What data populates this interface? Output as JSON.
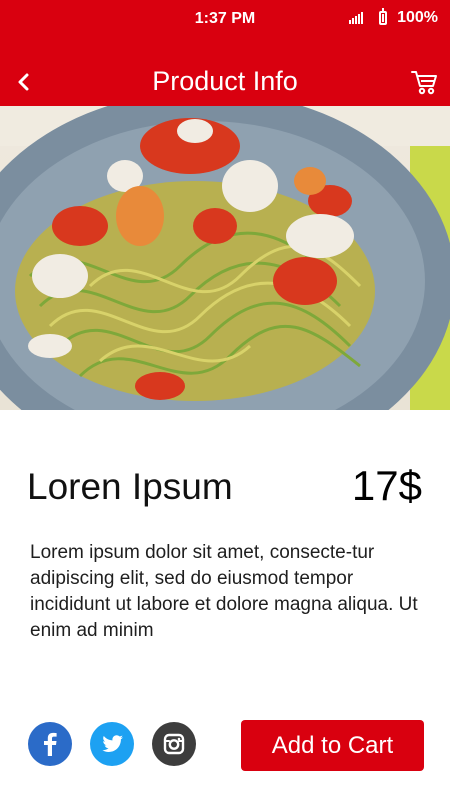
{
  "status_bar": {
    "time": "1:37 PM",
    "battery": "100%"
  },
  "header": {
    "title": "Product Info"
  },
  "product": {
    "name": "Loren Ipsum",
    "price": "17$",
    "description": "Lorem ipsum dolor sit amet, consecte-tur adipiscing elit, sed do eiusmod tempor incididunt ut labore et dolore magna aliqua. Ut enim ad minim"
  },
  "actions": {
    "add_to_cart": "Add to Cart"
  },
  "social": [
    "facebook-icon",
    "twitter-icon",
    "instagram-icon"
  ],
  "colors": {
    "brand_red": "#d9000f",
    "facebook": "#2b6bc8",
    "twitter": "#1da1f2",
    "instagram": "#3d3d3d"
  }
}
